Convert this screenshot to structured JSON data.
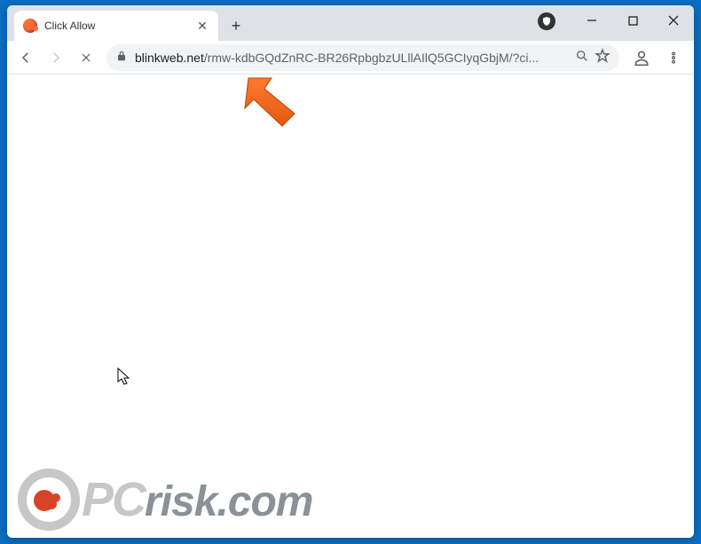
{
  "window": {
    "minimize": "–",
    "maximize": "☐",
    "close": "✕"
  },
  "tab": {
    "title": "Click Allow",
    "close": "✕"
  },
  "newtab": "+",
  "toolbar": {
    "url_domain": "blinkweb.net",
    "url_path": "/rmw-kdbGQdZnRC-BR26RpbgbzULllAIlQ5GCIyqGbjM/?ci..."
  },
  "watermark": {
    "pc": "PC",
    "risk": "risk.com"
  }
}
